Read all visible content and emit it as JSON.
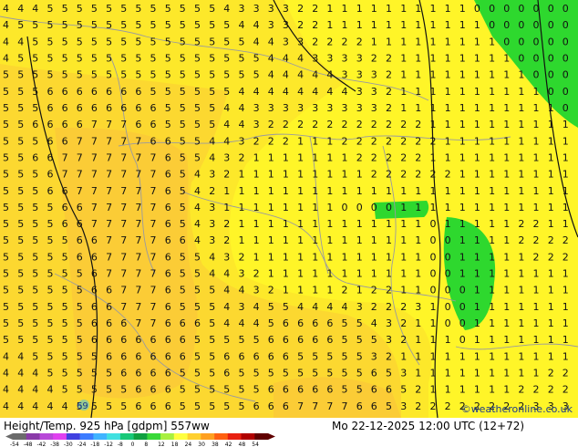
{
  "title": "Height/Temp. 925 hPa [gdpm] 557ww",
  "valid_time": "Mo 22-12-2025 12:00 UTC (12+72)",
  "credit": "©weatheronline.co.uk",
  "marker_label": "69",
  "colorbar": {
    "labels": [
      "-54",
      "-48",
      "-42",
      "-38",
      "-30",
      "-24",
      "-18",
      "-12",
      "-8",
      "0",
      "8",
      "12",
      "18",
      "24",
      "30",
      "38",
      "42",
      "48",
      "54"
    ],
    "colors": [
      "#6b6b6b",
      "#8a3aa8",
      "#b848d8",
      "#e040f0",
      "#4040e0",
      "#3c7cff",
      "#40b4ff",
      "#40e0e0",
      "#18c878",
      "#10a040",
      "#38d838",
      "#a8f040",
      "#ffff40",
      "#ffd030",
      "#ffa020",
      "#ff6010",
      "#e82010",
      "#b00000",
      "#600000"
    ]
  },
  "legend_colors": {
    "zone_4": "#fff528",
    "zone_5": "#fde82a",
    "zone_6": "#fcd830",
    "zone_7": "#fbcc36",
    "cold_zone": "#2ed82e",
    "contour": "#111111",
    "border": "#9a9aa0"
  },
  "grid_values": [
    "4 4 4 5 5 5 5 5 5 5 5 5 5 5 5 4 3 3 3 3 2 2 1 1 1 1 1 1 1 1 1 1 0 0 0 0 0 0 0",
    "4 5 5 5 5 5 5 5 5 5 5 5 5 5 5 5 4 4 3 3 2 2 1 1 1 1 1 1 1 1 1 1 1 0 0 0 0 0 0",
    "4 4 5 5 5 5 5 5 5 5 5 5 5 5 5 5 5 4 4 3 3 2 2 2 2 1 1 1 1 1 1 1 1 1 0 0 0 0 0",
    "4 5 5 5 5 5 5 5 5 5 5 5 5 5 5 5 5 5 4 4 4 3 3 3 3 2 2 1 1 1 1 1 1 1 1 0 0 0 0",
    "5 5 5 5 5 5 5 5 5 5 5 5 5 5 5 5 5 5 4 4 4 4 4 3 3 3 2 1 1 1 1 1 1 1 1 1 0 0 0",
    "5 5 5 6 6 6 6 6 6 6 5 5 5 5 5 5 4 4 4 4 4 4 4 4 3 3 2 1 1 1 1 1 1 1 1 1 1 0 0",
    "5 5 5 6 6 6 6 6 6 6 6 5 5 5 5 4 4 3 3 3 3 3 3 3 3 3 2 1 1 1 1 1 1 1 1 1 1 1 0",
    "5 5 6 6 6 6 7 7 7 6 6 5 5 5 5 4 4 3 2 2 2 2 2 2 2 2 2 2 2 1 1 1 1 1 1 1 1 1 1",
    "5 5 5 6 6 7 7 7 7 7 6 6 5 5 4 4 3 2 2 2 1 1 1 2 2 2 2 2 2 2 1 1 1 1 1 1 1 1 1",
    "5 5 6 6 7 7 7 7 7 7 7 6 5 5 4 3 2 1 1 1 1 1 1 1 2 2 2 2 2 1 1 1 1 1 1 1 1 1 1",
    "5 5 5 6 7 7 7 7 7 7 7 6 5 4 3 2 1 1 1 1 1 1 1 1 1 2 2 2 2 2 2 1 1 1 1 1 1 1 1",
    "5 5 5 6 6 7 7 7 7 7 7 6 5 4 2 1 1 1 1 1 1 1 1 1 1 1 1 1 1 1 1 1 1 1 1 1 1 1 1",
    "5 5 5 5 6 6 7 7 7 7 7 6 5 4 3 1 1 1 1 1 1 1 1 0 0 0 0 1 1 1 1 1 1 1 1 1 1 1 1",
    "5 5 5 5 6 6 7 7 7 7 7 6 5 4 3 2 1 1 1 1 1 1 1 1 1 1 1 1 1 0 1 1 1 1 1 2 2 1 1",
    "5 5 5 5 5 6 6 7 7 7 7 6 6 4 3 2 1 1 1 1 1 1 1 1 1 1 1 1 1 0 0 1 1 1 1 2 2 2 2",
    "5 5 5 5 5 6 6 7 7 7 7 6 5 5 4 3 2 1 1 1 1 1 1 1 1 1 1 1 1 0 0 1 1 1 1 1 2 2 2",
    "5 5 5 5 5 5 6 7 7 7 7 6 5 5 4 4 3 2 1 1 1 1 1 1 1 1 1 1 1 0 0 1 1 1 1 1 1 1 1",
    "5 5 5 5 5 5 6 6 7 7 7 6 5 5 5 4 4 3 2 1 1 1 1 2 1 2 2 1 1 0 0 0 1 1 1 1 1 1 1",
    "5 5 5 5 5 5 6 6 7 7 7 6 5 5 5 4 3 4 5 5 4 4 4 4 3 2 2 2 3 1 0 0 1 1 1 1 1 1 1",
    "5 5 5 5 5 5 6 6 6 7 7 6 6 6 5 4 4 4 5 6 6 6 6 5 5 4 3 2 1 1 0 0 1 1 1 1 1 1 1",
    "5 5 5 5 5 5 6 6 6 6 6 6 6 5 5 5 5 5 6 6 6 6 6 5 5 5 3 2 1 1 1 0 1 1 1 1 1 1 1",
    "4 4 5 5 5 5 5 6 6 6 6 6 6 5 5 6 6 6 6 6 5 5 5 5 5 3 2 1 1 1 1 1 1 1 1 1 1 1 1",
    "4 4 4 5 5 5 5 5 6 6 6 6 5 5 5 6 5 5 5 5 5 5 5 5 5 6 5 3 1 1 1 1 1 1 1 1 1 2 2",
    "4 4 4 4 5 5 5 5 5 6 6 6 5 5 5 5 5 5 6 6 6 6 6 5 5 6 6 5 2 1 1 1 1 1 1 2 2 2 2",
    "4 4 4 4 4 5 5 5 5 6 6 6 5 5 5 5 5 6 6 6 7 7 7 7 6 6 5 3 2 2 2 2 2 2 2 2 3 3 3"
  ]
}
